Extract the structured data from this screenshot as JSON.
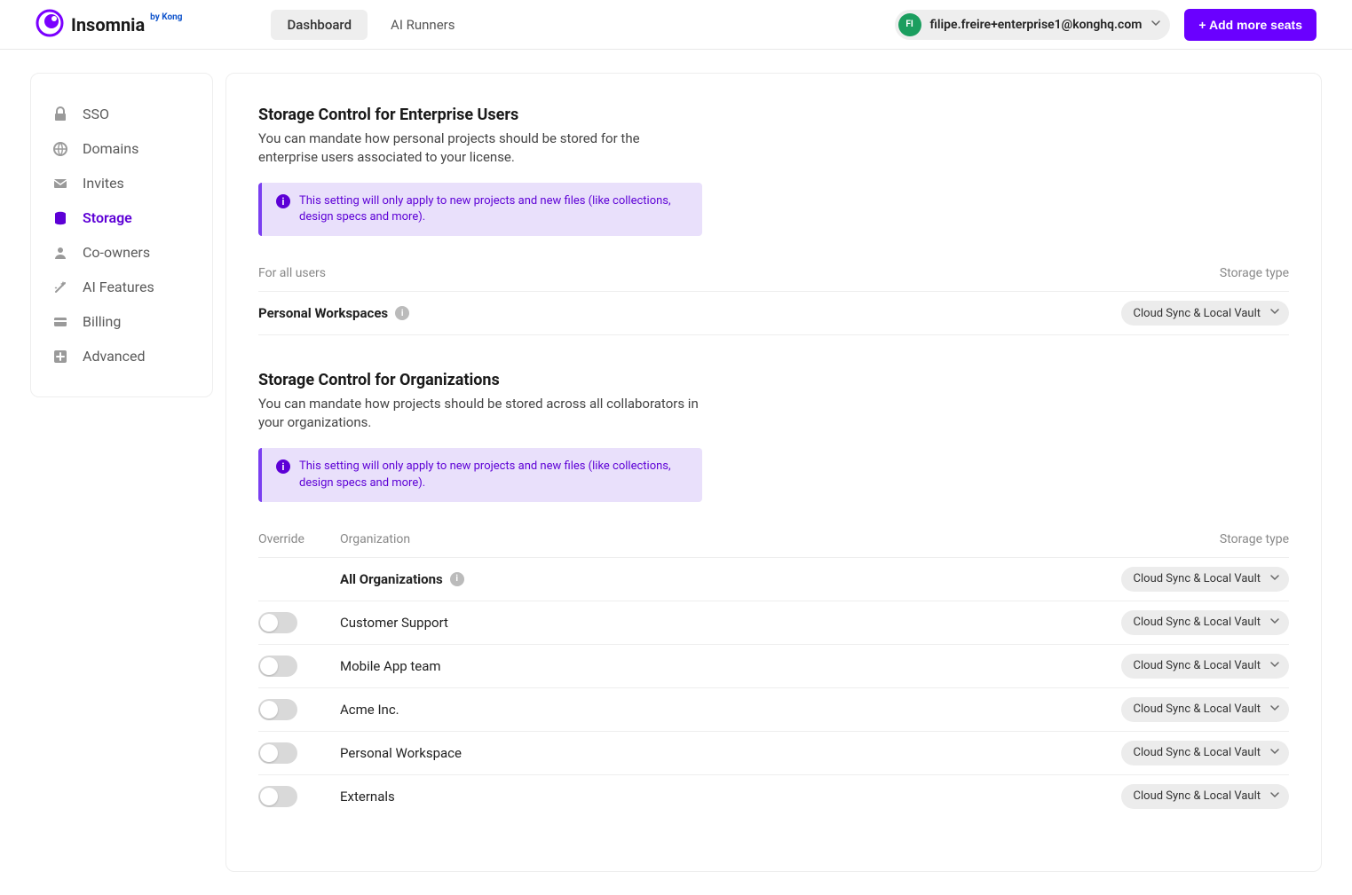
{
  "header": {
    "brand": "Insomnia",
    "byline_prefix": "by",
    "byline_name": "Kong",
    "tabs": [
      {
        "label": "Dashboard",
        "active": true
      },
      {
        "label": "AI Runners",
        "active": false
      }
    ],
    "user_avatar_initials": "FI",
    "user_email": "filipe.freire+enterprise1@konghq.com",
    "add_seats_label": "+ Add more seats"
  },
  "sidebar": {
    "items": [
      {
        "label": "SSO",
        "icon": "lock-icon"
      },
      {
        "label": "Domains",
        "icon": "globe-icon"
      },
      {
        "label": "Invites",
        "icon": "mail-icon"
      },
      {
        "label": "Storage",
        "icon": "storage-icon",
        "active": true
      },
      {
        "label": "Co-owners",
        "icon": "user-icon"
      },
      {
        "label": "AI Features",
        "icon": "wand-icon"
      },
      {
        "label": "Billing",
        "icon": "card-icon"
      },
      {
        "label": "Advanced",
        "icon": "plus-square-icon"
      }
    ]
  },
  "enterprise_section": {
    "title": "Storage Control for Enterprise Users",
    "description": "You can mandate how personal projects should be stored for the enterprise users associated to your license.",
    "banner": "This setting will only apply to new projects and new files (like collections, design specs and more).",
    "for_all_users_label": "For all users",
    "storage_type_label": "Storage type",
    "personal_workspaces_label": "Personal Workspaces",
    "personal_workspaces_storage": "Cloud Sync & Local Vault"
  },
  "org_section": {
    "title": "Storage Control for Organizations",
    "description": "You can mandate how projects should be stored across all collaborators in your organizations.",
    "banner": "This setting will only apply to new projects and new files (like collections, design specs and more).",
    "col_override": "Override",
    "col_organization": "Organization",
    "col_storage": "Storage type",
    "all_orgs_label": "All Organizations",
    "rows": [
      {
        "name": "Customer Support",
        "storage": "Cloud Sync & Local Vault"
      },
      {
        "name": "Mobile App team",
        "storage": "Cloud Sync & Local Vault"
      },
      {
        "name": "Acme Inc.",
        "storage": "Cloud Sync & Local Vault"
      },
      {
        "name": "Personal Workspace",
        "storage": "Cloud Sync & Local Vault"
      },
      {
        "name": "Externals",
        "storage": "Cloud Sync & Local Vault"
      }
    ],
    "all_orgs_storage": "Cloud Sync & Local Vault"
  }
}
